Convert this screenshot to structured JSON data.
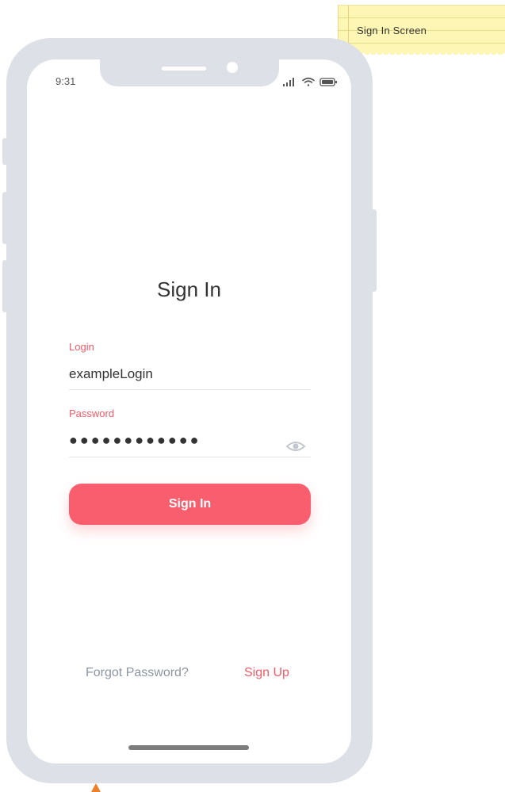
{
  "annotation": {
    "note_text": "Sign In Screen"
  },
  "status_bar": {
    "time": "9:31",
    "icons": [
      "signal-icon",
      "wifi-icon",
      "battery-icon"
    ]
  },
  "screen": {
    "title": "Sign In",
    "login": {
      "label": "Login",
      "value": "exampleLogin"
    },
    "password": {
      "label": "Password",
      "masked_value": "●●●●●●●●●●●●",
      "toggle_icon": "eye-icon"
    },
    "sign_in_button": {
      "label": "Sign In"
    },
    "forgot_password_link": "Forgot Password?",
    "sign_up_link": "Sign Up"
  },
  "colors": {
    "accent": "#f95e6e",
    "label": "#f25a67",
    "frame": "#dde1e7",
    "muted_link": "#8c95a1",
    "sticky_note": "#fdf6b4",
    "marker": "#f07f2a"
  }
}
